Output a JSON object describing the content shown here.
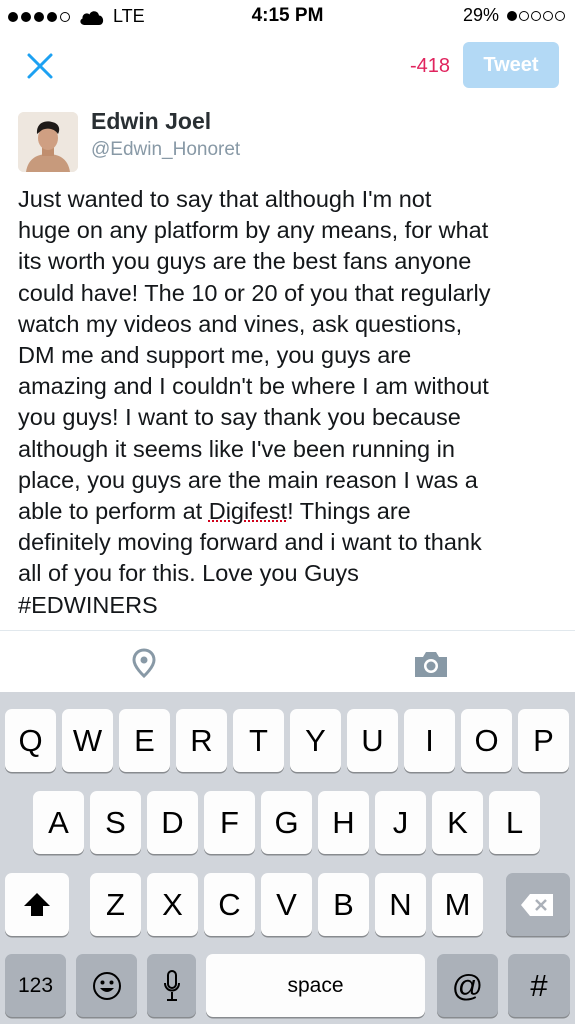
{
  "status_bar": {
    "carrier": "LTE",
    "time": "4:15 PM",
    "battery": "29%"
  },
  "compose": {
    "char_count": "-418",
    "tweet_button": "Tweet"
  },
  "user": {
    "name": "Edwin Joel",
    "handle": "@Edwin_Honoret"
  },
  "tweet": {
    "text_before": "Just wanted to say that although I'm not\nhuge on any platform by any means, for what\nits worth you guys are the best fans anyone\ncould have! The 10 or 20 of you that regularly\nwatch my videos and vines, ask questions,\nDM me and support me, you guys are\namazing and I couldn't be where I am without\nyou guys! I want to say thank you because\nalthough it seems like I've been running in\nplace, you guys are the main reason I was a\nable to perform at ",
    "misspelled_word": "Digifest",
    "text_after": "! Things are\ndefinitely moving forward and i want to thank\nall of you for this. Love you Guys\n#EDWINERS"
  },
  "keyboard": {
    "row1": [
      "Q",
      "W",
      "E",
      "R",
      "T",
      "Y",
      "U",
      "I",
      "O",
      "P"
    ],
    "row2": [
      "A",
      "S",
      "D",
      "F",
      "G",
      "H",
      "J",
      "K",
      "L"
    ],
    "row3": [
      "Z",
      "X",
      "C",
      "V",
      "B",
      "N",
      "M"
    ],
    "numbers_key": "123",
    "space_key": "space",
    "at_key": "@",
    "hash_key": "#"
  },
  "colors": {
    "char_count_red": "#e0245e",
    "tweet_button_disabled": "#b3d9f5",
    "twitter_blue": "#1da1f2",
    "icon_gray": "#8899a6"
  }
}
